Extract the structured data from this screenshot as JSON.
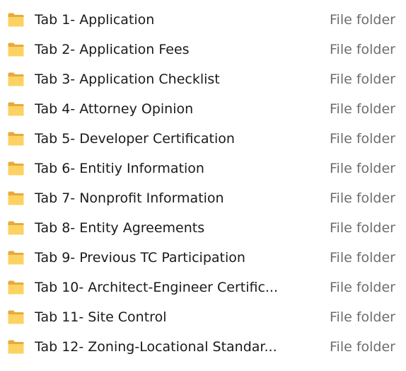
{
  "icon": "folder-icon",
  "colors": {
    "folder_body": "#FCD262",
    "folder_shade": "#E8A93A",
    "name_text": "#1A1A1A",
    "type_text": "#6D6D6D"
  },
  "files": [
    {
      "name": "Tab 1- Application",
      "type": "File folder"
    },
    {
      "name": "Tab 2- Application Fees",
      "type": "File folder"
    },
    {
      "name": "Tab 3- Application Checklist",
      "type": "File folder"
    },
    {
      "name": "Tab 4- Attorney Opinion",
      "type": "File folder"
    },
    {
      "name": "Tab 5- Developer Certification",
      "type": "File folder"
    },
    {
      "name": "Tab 6- Entitiy Information",
      "type": "File folder"
    },
    {
      "name": "Tab 7- Nonprofit Information",
      "type": "File folder"
    },
    {
      "name": "Tab 8- Entity Agreements",
      "type": "File folder"
    },
    {
      "name": "Tab 9- Previous TC Participation",
      "type": "File folder"
    },
    {
      "name": "Tab 10- Architect-Engineer Certific...",
      "type": "File folder"
    },
    {
      "name": "Tab 11- Site Control",
      "type": "File folder"
    },
    {
      "name": "Tab 12- Zoning-Locational Standar...",
      "type": "File folder"
    }
  ]
}
